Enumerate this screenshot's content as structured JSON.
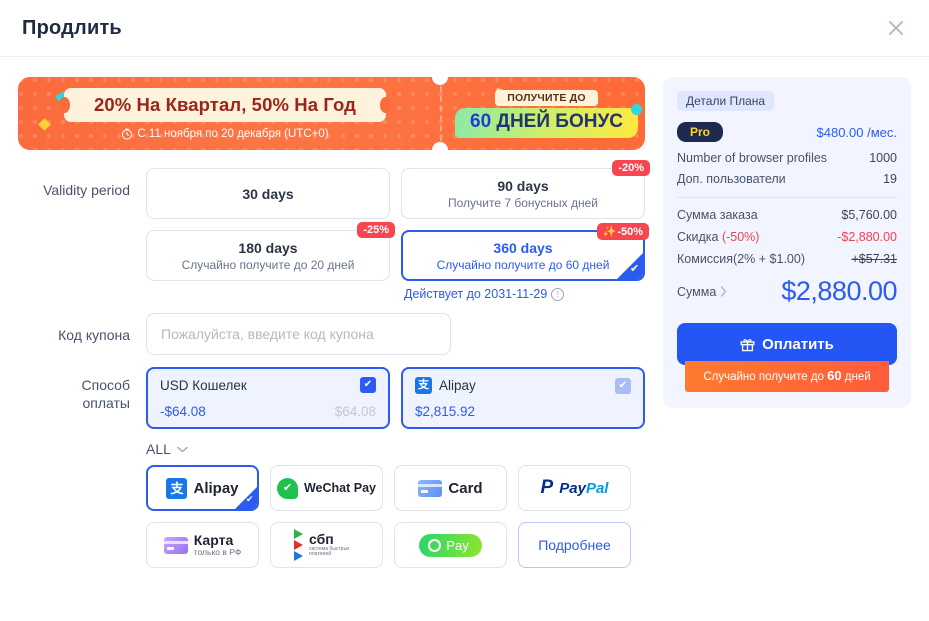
{
  "header": {
    "title": "Продлить",
    "close_icon": "close-icon"
  },
  "promo": {
    "headline": "20% На Квартал, 50% На Год",
    "date_icon": "timer-icon",
    "date_text": "С 11 ноября по 20 декабря (UTC+0)",
    "tag": "ПОЛУЧИТЕ ДО",
    "bonus_number": "60",
    "bonus_text": " ДНЕЙ БОНУС"
  },
  "validity": {
    "label": "Validity period",
    "options": [
      {
        "title": "30 days",
        "sub": "",
        "badge": "",
        "selected": false
      },
      {
        "title": "90 days",
        "sub": "Получите 7 бонусных дней",
        "badge": "-20%",
        "selected": false
      },
      {
        "title": "180 days",
        "sub": "Случайно получите до 20 дней",
        "badge": "-25%",
        "selected": false
      },
      {
        "title": "360 days",
        "sub": "Случайно получите до 60 дней",
        "badge": "-50%",
        "selected": true
      }
    ],
    "valid_until": "Действует до 2031-11-29",
    "info_icon": "info-icon"
  },
  "coupon": {
    "label": "Код купона",
    "placeholder": "Пожалуйста, введите код купона",
    "value": ""
  },
  "payment": {
    "label_line1": "Способ",
    "label_line2": "оплаты",
    "balances": [
      {
        "name": "USD Кошелек",
        "amount": "-$64.08",
        "grey": "$64.08",
        "checked": true,
        "icon": ""
      },
      {
        "name": "Alipay",
        "amount": "$2,815.92",
        "grey": "",
        "checked": true,
        "icon": "alipay-icon"
      }
    ],
    "filter_label": "ALL",
    "filter_icon": "chevron-down-icon",
    "tiles": [
      {
        "id": "alipay",
        "label": "Alipay",
        "sub": "",
        "selected": true
      },
      {
        "id": "wechat",
        "label": "WeChat Pay",
        "sub": "",
        "selected": false
      },
      {
        "id": "card",
        "label": "Card",
        "sub": "",
        "selected": false
      },
      {
        "id": "paypal",
        "label": "PayPal",
        "sub": "",
        "selected": false
      },
      {
        "id": "karta",
        "label": "Карта",
        "sub": "только в РФ",
        "selected": false
      },
      {
        "id": "sbp",
        "label": "сбп",
        "sub": "система быстрых платежей",
        "selected": false
      },
      {
        "id": "spay",
        "label": "Pay",
        "sub": "",
        "selected": false
      },
      {
        "id": "more",
        "label": "Подробнее",
        "sub": "",
        "selected": false
      }
    ]
  },
  "panel": {
    "tag": "Детали Плана",
    "plan_badge": "Pro",
    "plan_price": "$480.00 /мес.",
    "specs": [
      {
        "k": "Number of browser profiles",
        "v": "1000"
      },
      {
        "k": "Доп. пользователи",
        "v": "19"
      }
    ],
    "sums": [
      {
        "k": "Сумма заказа",
        "k_extra": "",
        "v": "$5,760.00",
        "style": ""
      },
      {
        "k": "Скидка ",
        "k_extra": "(-50%)",
        "v": "-$2,880.00",
        "style": "red"
      },
      {
        "k": "Комиссия(2% + $1.00)",
        "k_extra": "",
        "v": "+$57.31",
        "style": "strike"
      }
    ],
    "total_label": "Сумма",
    "total_arrow_icon": "chevron-right-icon",
    "total_value": "$2,880.00",
    "pay_button": "Оплатить",
    "pay_icon": "gift-icon",
    "ribbon_pre": "Случайно получите до ",
    "ribbon_num": "60",
    "ribbon_post": " дней"
  }
}
